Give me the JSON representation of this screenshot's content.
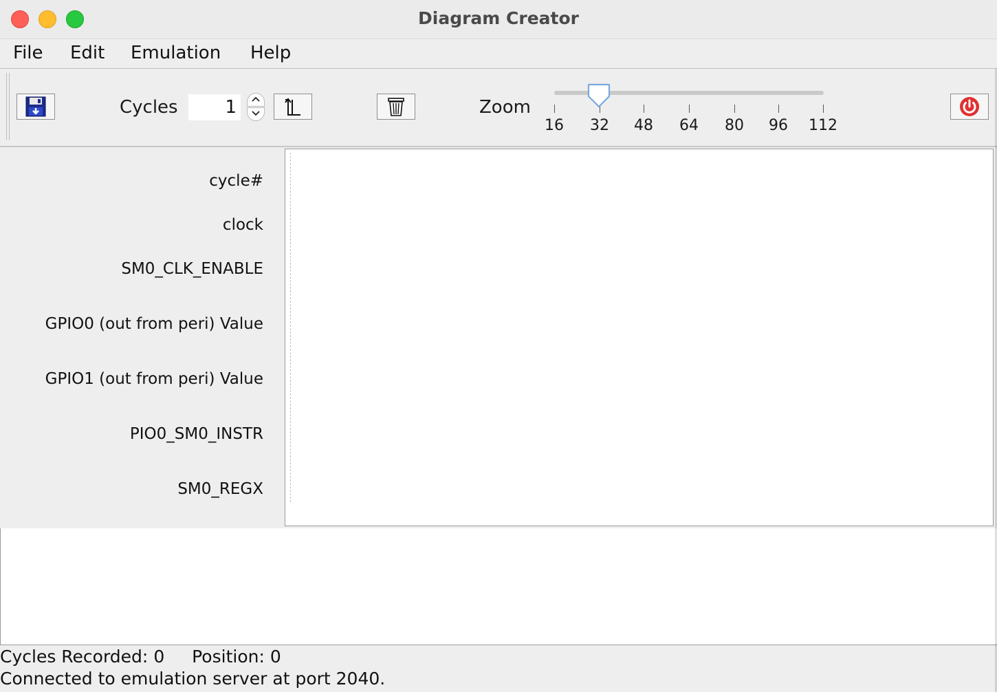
{
  "window": {
    "title": "Diagram Creator"
  },
  "menu": [
    "File",
    "Edit",
    "Emulation",
    "Help"
  ],
  "toolbar": {
    "cycles_label": "Cycles",
    "cycles_value": "1",
    "zoom_label": "Zoom",
    "zoom_value": 32,
    "zoom_ticks": [
      "16",
      "32",
      "48",
      "64",
      "80",
      "96",
      "112"
    ],
    "icons": {
      "save": "floppy-disk-icon",
      "step": "clock-edge-icon",
      "clear": "trash-icon",
      "power": "power-icon"
    },
    "accent": "#e03030"
  },
  "signals": [
    "cycle#",
    "clock",
    "SM0_CLK_ENABLE",
    "GPIO0 (out from peri) Value",
    "GPIO1 (out from peri) Value",
    "PIO0_SM0_INSTR",
    "SM0_REGX"
  ],
  "status": {
    "recorded_label": "Cycles Recorded:",
    "recorded_value": "0",
    "position_label": "Position:",
    "position_value": "0",
    "message": "Connected to emulation server at port 2040."
  }
}
